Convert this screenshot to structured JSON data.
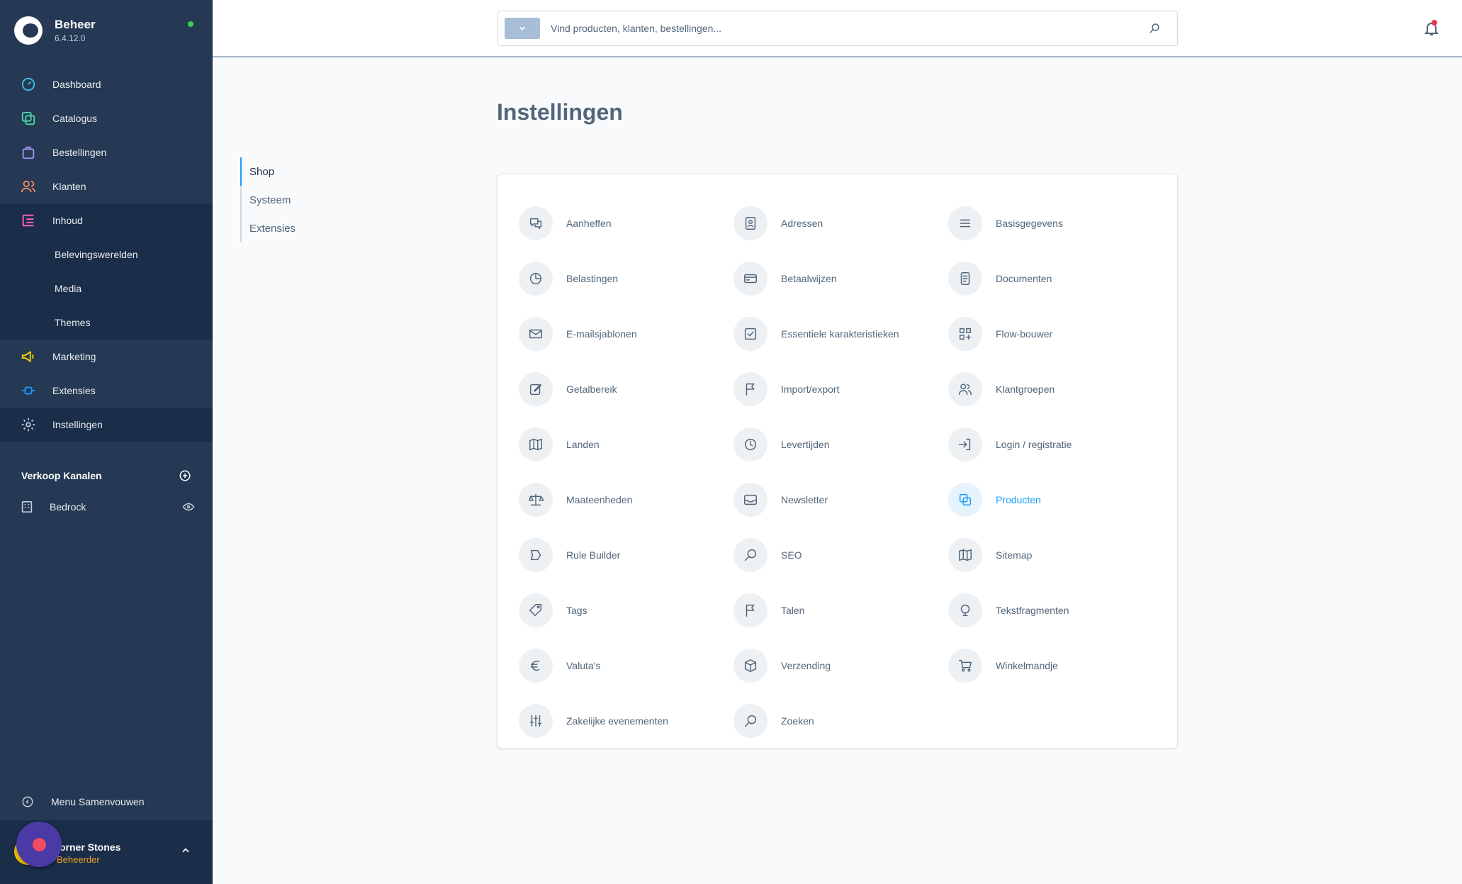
{
  "app": {
    "name": "Beheer",
    "version": "6.4.12.0"
  },
  "nav": {
    "dashboard": "Dashboard",
    "catalogus": "Catalogus",
    "bestellingen": "Bestellingen",
    "klanten": "Klanten",
    "inhoud": "Inhoud",
    "belevingswerelden": "Belevingswerelden",
    "media": "Media",
    "themes": "Themes",
    "marketing": "Marketing",
    "extensies": "Extensies",
    "instellingen": "Instellingen"
  },
  "sales_channels": {
    "title": "Verkoop Kanalen",
    "items": [
      {
        "label": "Bedrock"
      }
    ]
  },
  "collapse_label": "Menu Samenvouwen",
  "user": {
    "name": "orner Stones",
    "role": "Beheerder"
  },
  "search": {
    "placeholder": "Vind producten, klanten, bestellingen..."
  },
  "page": {
    "title": "Instellingen"
  },
  "tabs": [
    "Shop",
    "Systeem",
    "Extensies"
  ],
  "settings": [
    {
      "label": "Aanheffen",
      "icon": "chat-icon"
    },
    {
      "label": "Adressen",
      "icon": "address-book-icon"
    },
    {
      "label": "Basisgegevens",
      "icon": "list-icon"
    },
    {
      "label": "Belastingen",
      "icon": "pie-chart-icon"
    },
    {
      "label": "Betaalwijzen",
      "icon": "credit-card-icon"
    },
    {
      "label": "Documenten",
      "icon": "document-icon"
    },
    {
      "label": "E-mailsjablonen",
      "icon": "envelope-icon"
    },
    {
      "label": "Essentiele karakteristieken",
      "icon": "checkbox-icon"
    },
    {
      "label": "Flow-bouwer",
      "icon": "flow-icon"
    },
    {
      "label": "Getalbereik",
      "icon": "edit-icon"
    },
    {
      "label": "Import/export",
      "icon": "flag-icon"
    },
    {
      "label": "Klantgroepen",
      "icon": "users-icon"
    },
    {
      "label": "Landen",
      "icon": "map-icon"
    },
    {
      "label": "Levertijden",
      "icon": "clock-icon"
    },
    {
      "label": "Login / registratie",
      "icon": "sign-in-icon"
    },
    {
      "label": "Maateenheden",
      "icon": "scale-icon"
    },
    {
      "label": "Newsletter",
      "icon": "inbox-icon"
    },
    {
      "label": "Producten",
      "icon": "products-icon",
      "highlight": true
    },
    {
      "label": "Rule Builder",
      "icon": "rule-icon"
    },
    {
      "label": "SEO",
      "icon": "search-icon"
    },
    {
      "label": "Sitemap",
      "icon": "map-icon"
    },
    {
      "label": "Tags",
      "icon": "tag-icon"
    },
    {
      "label": "Talen",
      "icon": "flag-icon"
    },
    {
      "label": "Tekstfragmenten",
      "icon": "snippet-icon"
    },
    {
      "label": "Valuta's",
      "icon": "euro-icon"
    },
    {
      "label": "Verzending",
      "icon": "package-icon"
    },
    {
      "label": "Winkelmandje",
      "icon": "cart-icon"
    },
    {
      "label": "Zakelijke evenementen",
      "icon": "sliders-icon"
    },
    {
      "label": "Zoeken",
      "icon": "search-icon"
    }
  ],
  "colors": {
    "sidebar": "#253954",
    "sidebar_active": "#1a2d49",
    "accent": "#189eff",
    "online": "#37d046",
    "notification": "#e63a4b"
  }
}
